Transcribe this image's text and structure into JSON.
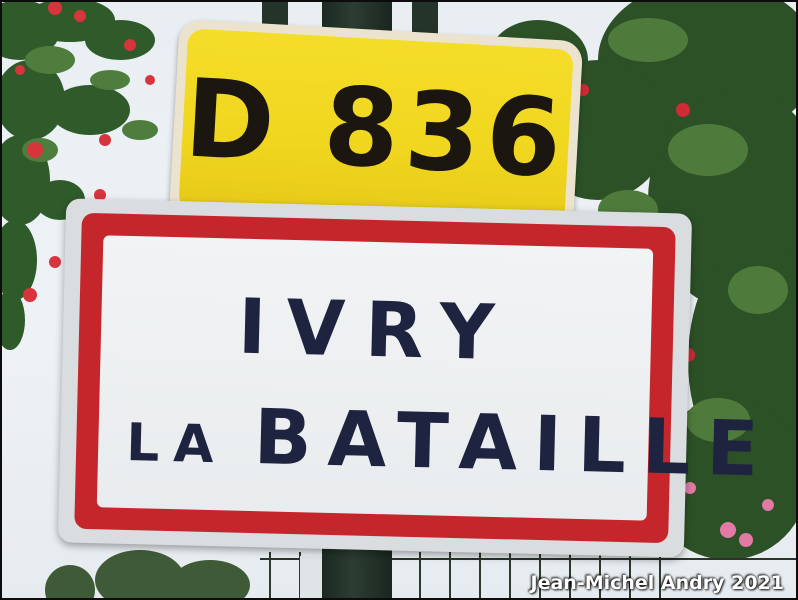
{
  "road_sign": {
    "number": "D 836",
    "colors": {
      "plate": "#f0d61e",
      "text": "#1b1710"
    }
  },
  "town_sign": {
    "line1": "IVRY",
    "line2_small": "LA",
    "line2_big": "BATAILLE",
    "colors": {
      "border": "#c4262b",
      "panel": "#eceff0",
      "text": "#1e2340"
    }
  },
  "credit": "Jean-Michel Andry 2021"
}
